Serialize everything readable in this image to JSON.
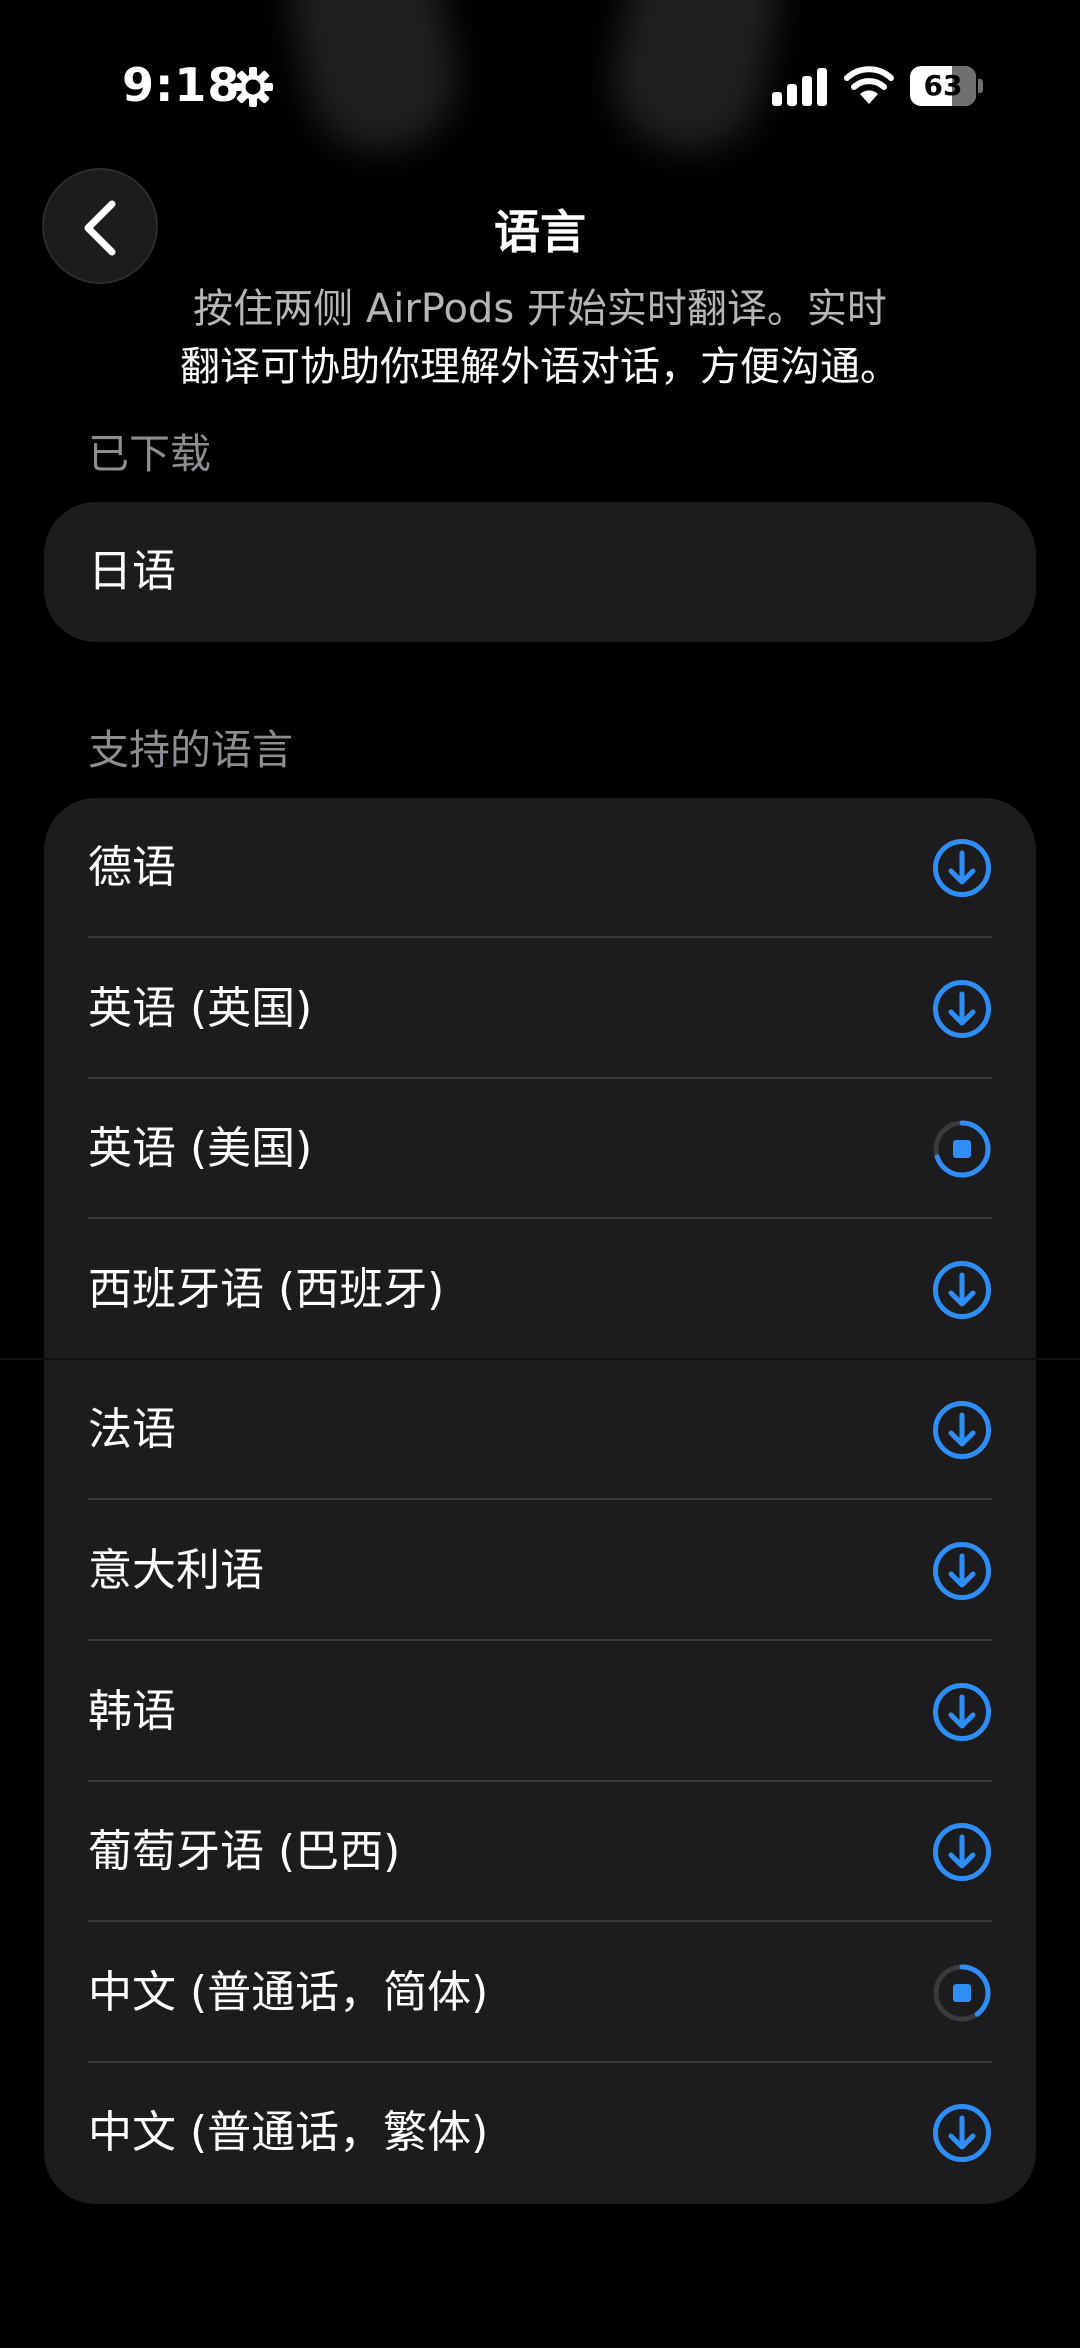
{
  "status_bar": {
    "time": "9:18",
    "battery": "63",
    "battery_level": 0.63
  },
  "nav": {
    "title": "语言"
  },
  "description": {
    "line1": "按住两侧 AirPods 开始实时翻译。实时",
    "line2": "翻译可协助你理解外语对话，方便沟通。"
  },
  "downloaded": {
    "header": "已下载",
    "items": [
      {
        "label": "日语"
      }
    ]
  },
  "supported": {
    "header": "支持的语言",
    "items": [
      {
        "label": "德语",
        "state": "download"
      },
      {
        "label": "英语 (英国)",
        "state": "download"
      },
      {
        "label": "英语 (美国)",
        "state": "downloading",
        "progress": 0.7
      },
      {
        "label": "西班牙语 (西班牙)",
        "state": "download"
      },
      {
        "label": "法语",
        "state": "download"
      },
      {
        "label": "意大利语",
        "state": "download"
      },
      {
        "label": "韩语",
        "state": "download"
      },
      {
        "label": "葡萄牙语 (巴西)",
        "state": "download"
      },
      {
        "label": "中文 (普通话，简体)",
        "state": "downloading",
        "progress": 0.4
      },
      {
        "label": "中文 (普通话，繁体)",
        "state": "download"
      }
    ]
  },
  "colors": {
    "accent": "#2f8ef5",
    "card": "#1c1c1e",
    "divider": "#38383a",
    "secondary_text": "#8d8d92"
  }
}
